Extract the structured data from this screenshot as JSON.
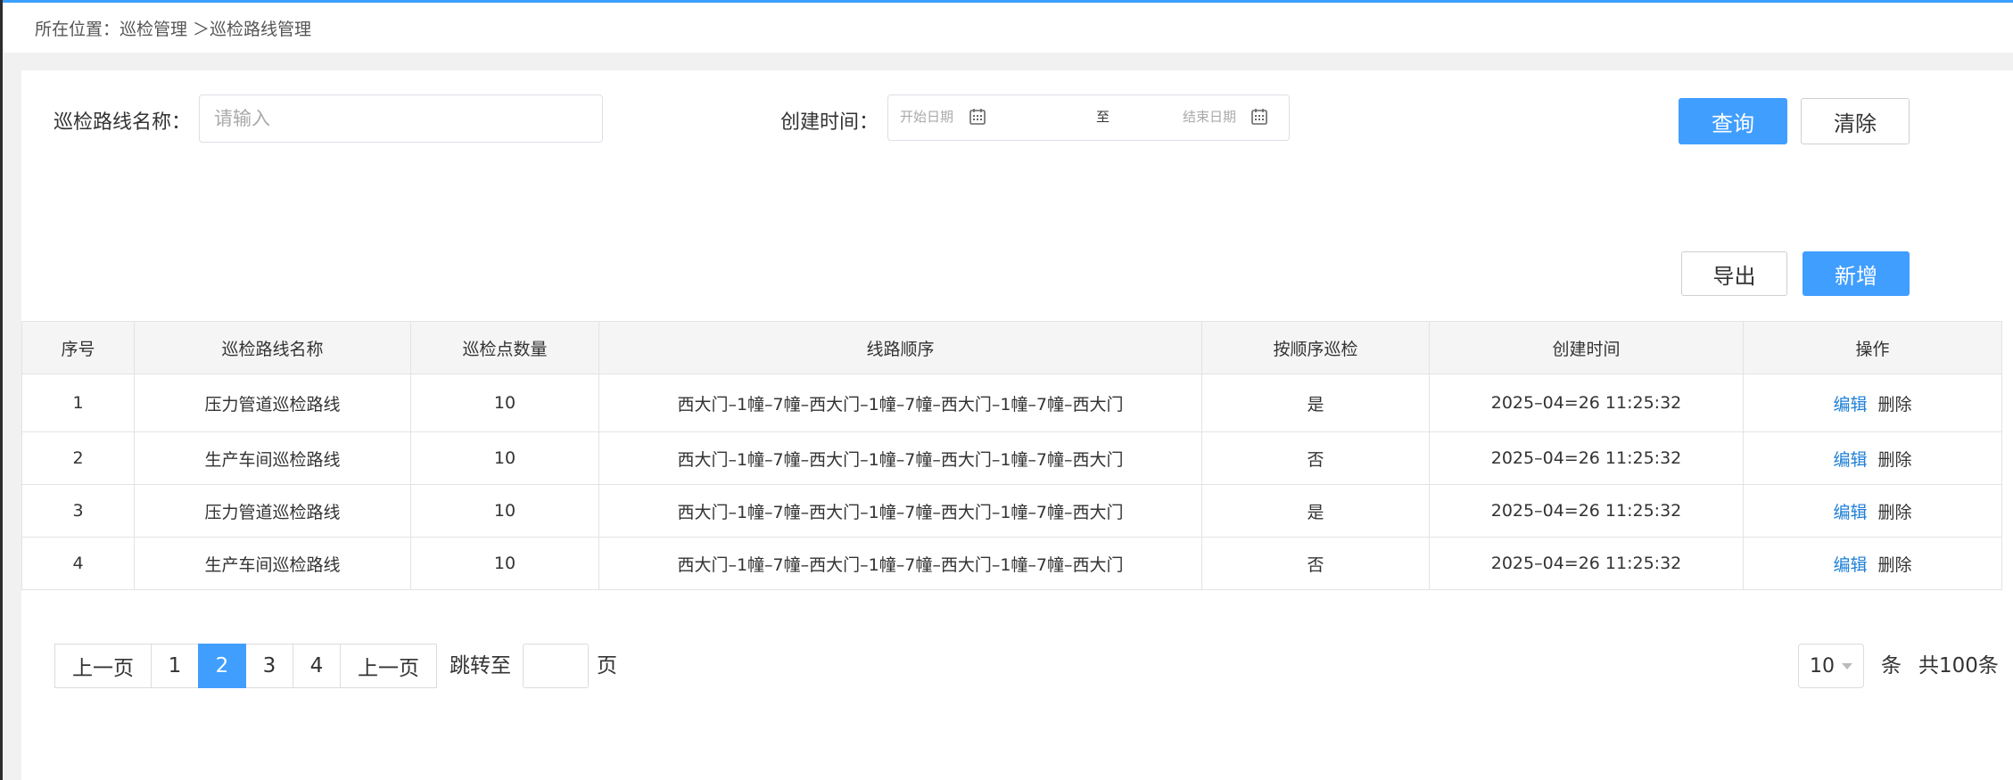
{
  "breadcrumb": {
    "text": "所在位置：巡检管理 ＞巡检路线管理"
  },
  "search": {
    "name_label": "巡检路线名称：",
    "name_placeholder": "请输入",
    "date_label": "创建时间：",
    "start_placeholder": "开始日期",
    "separator": "至",
    "end_placeholder": "结束日期",
    "query_label": "查询",
    "clear_label": "清除"
  },
  "toolbar": {
    "export_label": "导出",
    "add_label": "新增"
  },
  "table": {
    "headers": [
      "序号",
      "巡检路线名称",
      "巡检点数量",
      "线路顺序",
      "按顺序巡检",
      "创建时间",
      "操作"
    ],
    "rows": [
      {
        "index": "1",
        "name": "压力管道巡检路线",
        "count": "10",
        "route": "西大门–1幢–7幢–西大门–1幢–7幢–西大门–1幢–7幢–西大门",
        "ordered": "是",
        "created": "2025–04=26 11:25:32",
        "edit": "编辑",
        "delete": "删除"
      },
      {
        "index": "2",
        "name": "生产车间巡检路线",
        "count": "10",
        "route": "西大门–1幢–7幢–西大门–1幢–7幢–西大门–1幢–7幢–西大门",
        "ordered": "否",
        "created": "2025–04=26 11:25:32",
        "edit": "编辑",
        "delete": "删除"
      },
      {
        "index": "3",
        "name": "压力管道巡检路线",
        "count": "10",
        "route": "西大门–1幢–7幢–西大门–1幢–7幢–西大门–1幢–7幢–西大门",
        "ordered": "是",
        "created": "2025–04=26 11:25:32",
        "edit": "编辑",
        "delete": "删除"
      },
      {
        "index": "4",
        "name": "生产车间巡检路线",
        "count": "10",
        "route": "西大门–1幢–7幢–西大门–1幢–7幢–西大门–1幢–7幢–西大门",
        "ordered": "否",
        "created": "2025–04=26 11:25:32",
        "edit": "编辑",
        "delete": "删除"
      }
    ]
  },
  "pagination": {
    "prev_label": "上一页",
    "pages": [
      "1",
      "2",
      "3",
      "4"
    ],
    "active_page": "2",
    "next_label": "上一页",
    "jump_label": "跳转至",
    "jump_value": "",
    "page_unit": "页",
    "page_size": "10",
    "size_unit": "条",
    "total": "共100条"
  },
  "colors": {
    "accent": "#409eff",
    "link": "#1e7fd6",
    "top_bar": "#3aa0ff"
  },
  "icons": {
    "date_picker": "calendar-icon",
    "select": "chevron-down-icon"
  }
}
